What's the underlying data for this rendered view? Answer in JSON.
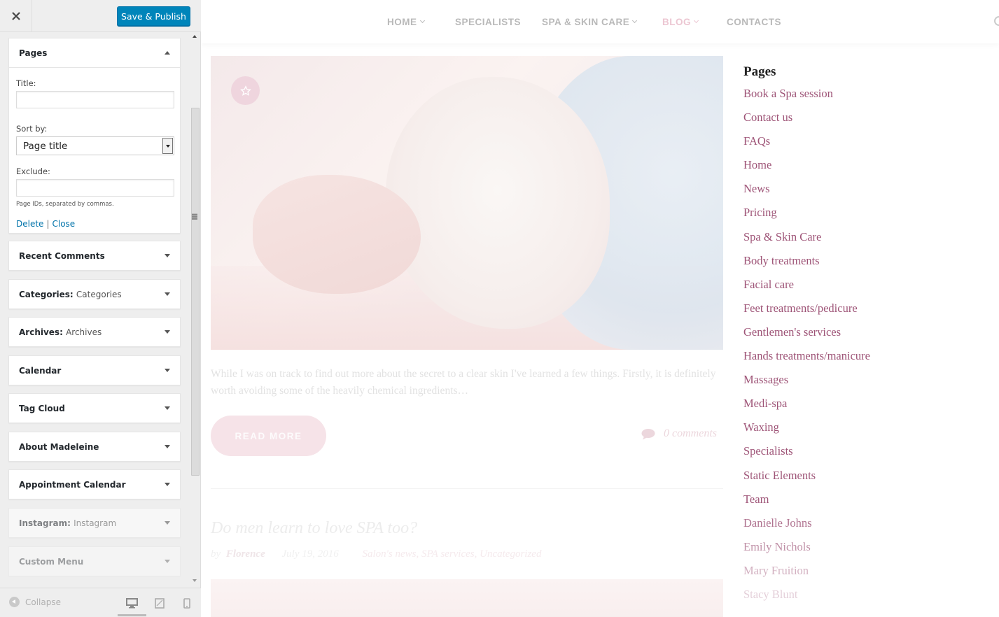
{
  "customizer": {
    "save_label": "Save & Publish",
    "pages_widget": {
      "title": "Pages",
      "title_label": "Title:",
      "title_value": "",
      "sortby_label": "Sort by:",
      "sortby_value": "Page title",
      "exclude_label": "Exclude:",
      "exclude_value": "",
      "exclude_help": "Page IDs, separated by commas.",
      "delete_label": "Delete",
      "separator": "|",
      "close_label": "Close"
    },
    "widgets": [
      {
        "title": "Recent Comments",
        "subtitle": ""
      },
      {
        "title": "Categories:",
        "subtitle": "Categories"
      },
      {
        "title": "Archives:",
        "subtitle": "Archives"
      },
      {
        "title": "Calendar",
        "subtitle": ""
      },
      {
        "title": "Tag Cloud",
        "subtitle": ""
      },
      {
        "title": "About Madeleine",
        "subtitle": ""
      },
      {
        "title": "Appointment Calendar",
        "subtitle": ""
      },
      {
        "title": "Instagram:",
        "subtitle": "Instagram"
      },
      {
        "title": "Custom Menu",
        "subtitle": ""
      }
    ],
    "collapse_label": "Collapse",
    "icons": {
      "close": "close-icon",
      "collapse": "collapse-icon",
      "desktop": "desktop-icon",
      "tablet": "tablet-icon",
      "mobile": "mobile-icon"
    }
  },
  "preview": {
    "nav": [
      {
        "label": "HOME"
      },
      {
        "label": "SPECIALISTS"
      },
      {
        "label": "SPA & SKIN CARE"
      },
      {
        "label": "BLOG"
      },
      {
        "label": "CONTACTS"
      }
    ],
    "post": {
      "excerpt": "While I was on track to find out more about the secret to a clear skin I've learned a few things. Firstly, it is definitely worth avoiding some of the heavily chemical ingredients…",
      "read_more": "READ MORE",
      "comments": "0 comments"
    },
    "post2": {
      "title": "Do men learn to love SPA too?",
      "by": "by",
      "author": "Florence",
      "date": "July 19, 2016",
      "categories": "Salon's news, SPA services, Uncategorized"
    },
    "sidebar": {
      "title": "Pages",
      "pages": [
        "Book a Spa session",
        "Contact us",
        "FAQs",
        "Home",
        "News",
        "Pricing",
        "Spa & Skin Care",
        "Body treatments",
        "Facial care",
        "Feet treatments/pedicure",
        "Gentlemen's services",
        "Hands treatments/manicure",
        "Massages",
        "Medi-spa",
        "Waxing",
        "Specialists",
        "Static Elements",
        "Team",
        "Danielle Johns",
        "Emily Nichols",
        "Mary Fruition",
        "Stacy Blunt"
      ]
    },
    "colors": {
      "accent": "#9e5477",
      "button": "#f6e3e8",
      "wp_blue": "#0085ba"
    }
  }
}
